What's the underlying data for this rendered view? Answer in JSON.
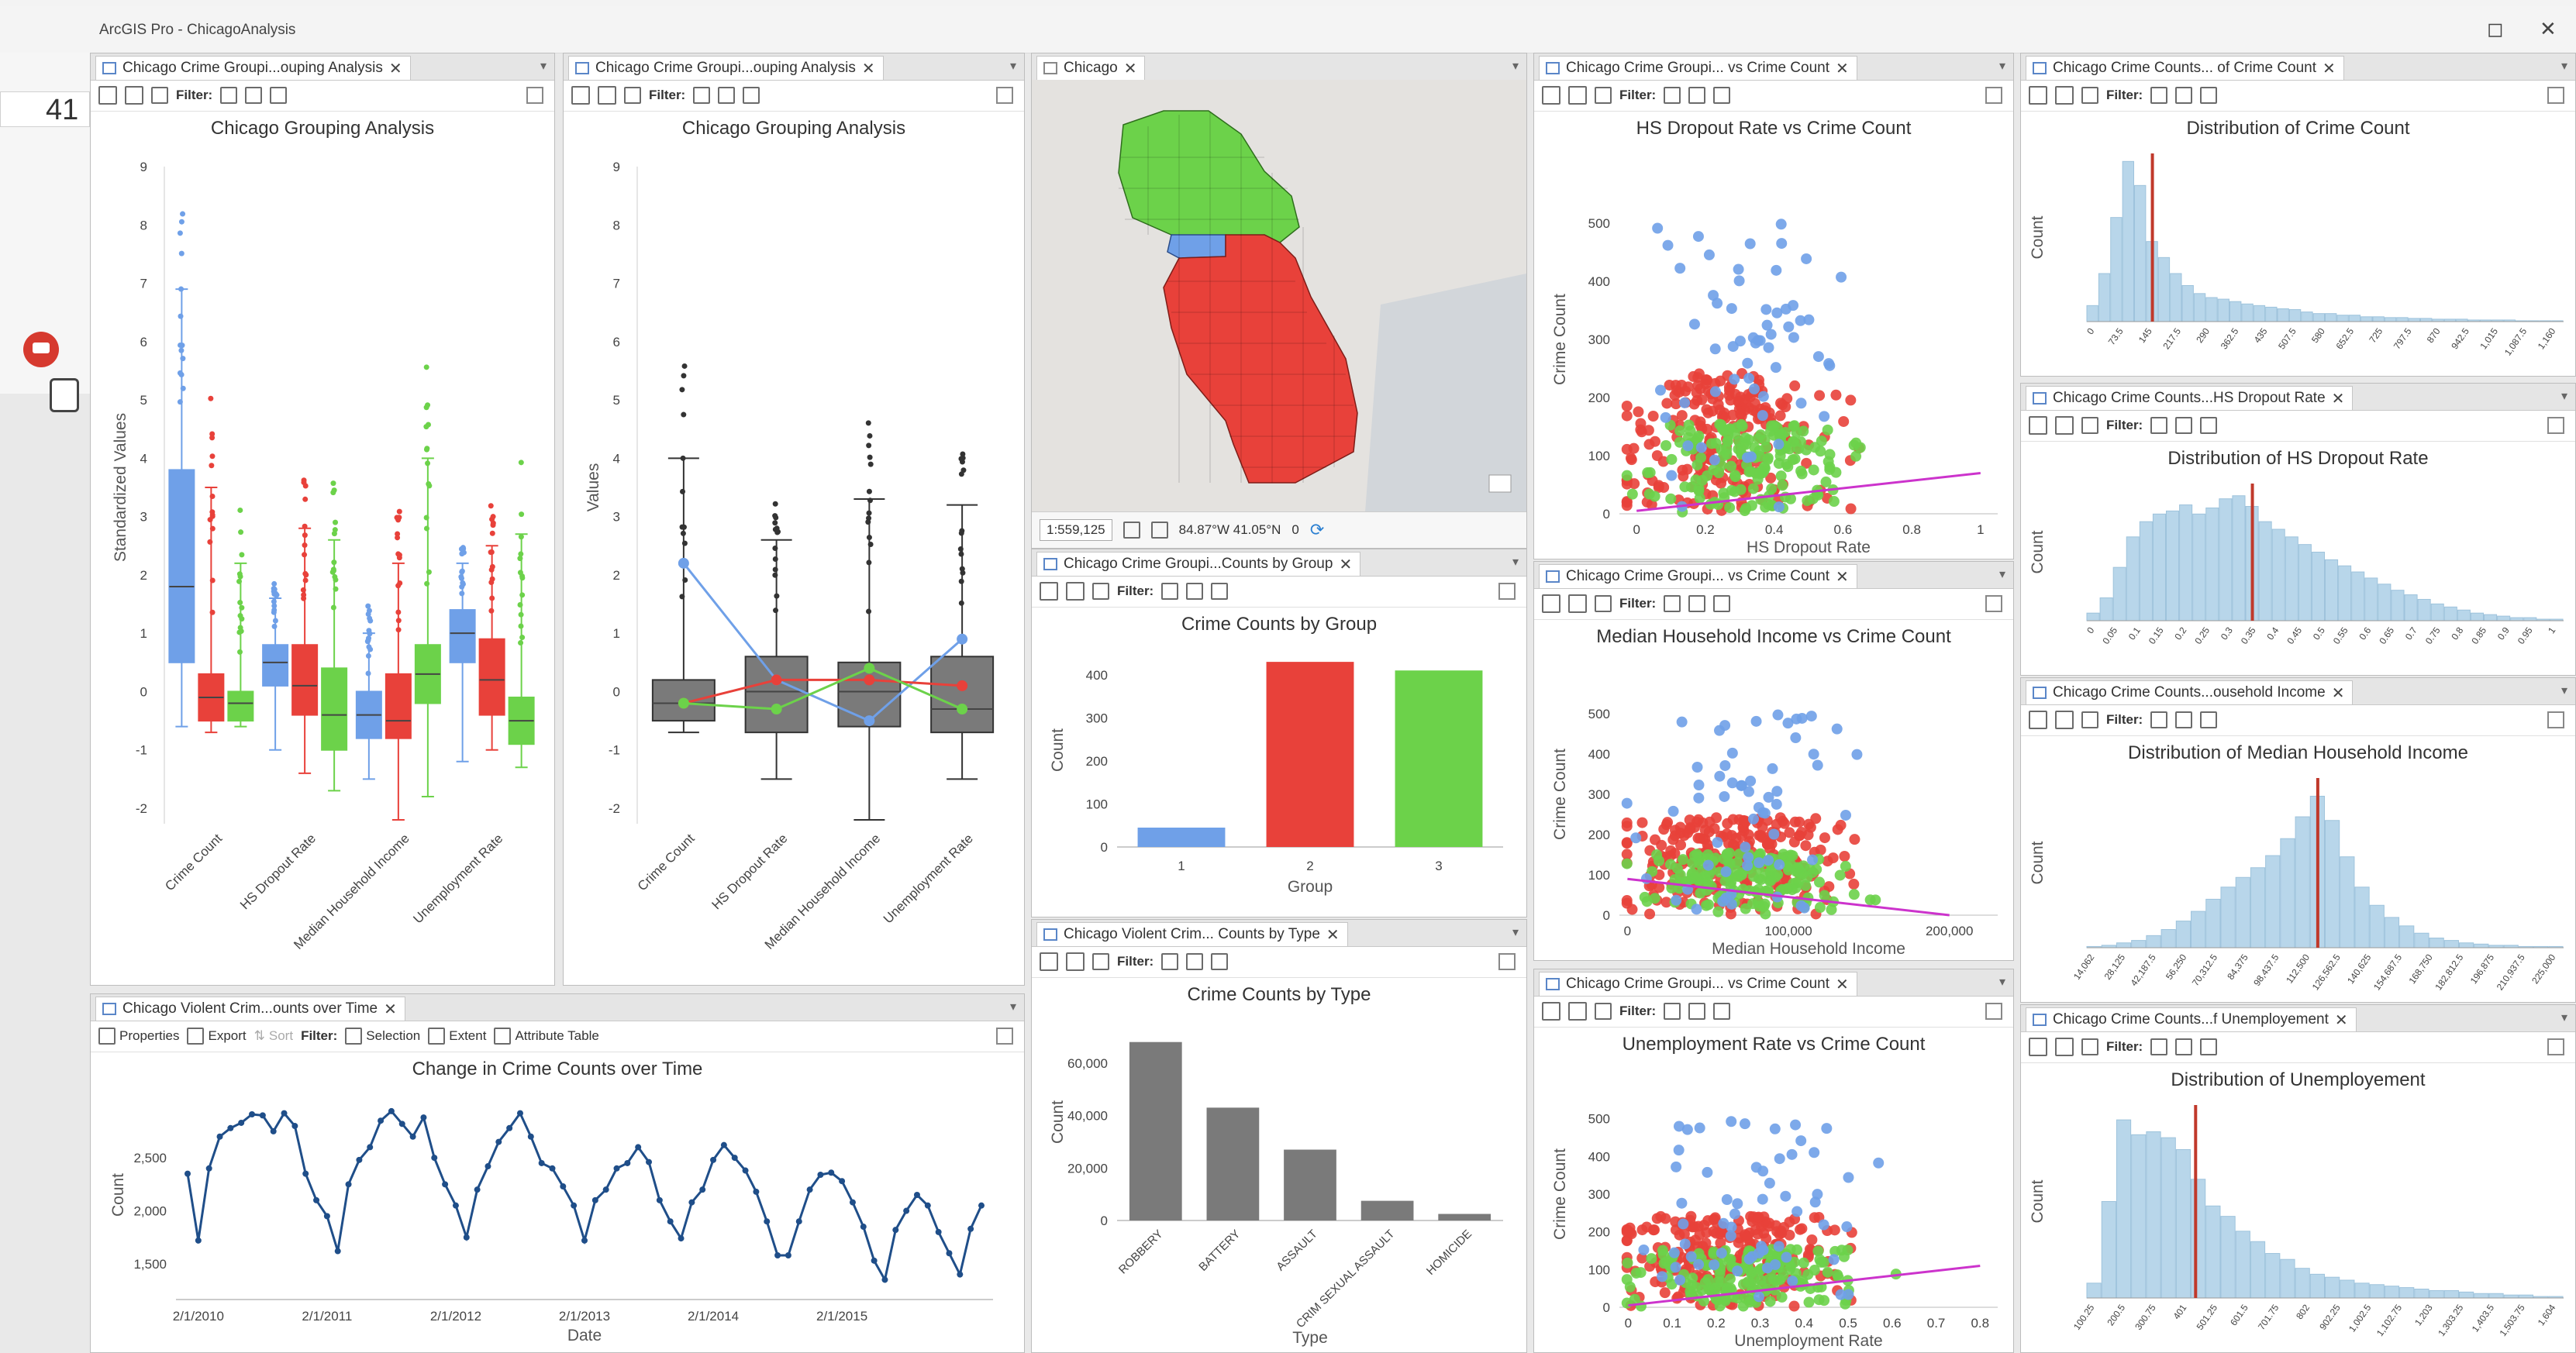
{
  "app": {
    "title": "ArcGIS Pro - ChicagoAnalysis",
    "restore": "◻",
    "close": "✕"
  },
  "side": {
    "badge": "41"
  },
  "toolbar": {
    "filter_label": "Filter:",
    "properties": "Properties",
    "export": "Export",
    "sort": "Sort",
    "selection": "Selection",
    "extent": "Extent",
    "attribute_table": "Attribute Table"
  },
  "colors": {
    "blue": "#6fa0e8",
    "red": "#e8413a",
    "green": "#6cd24a",
    "gray": "#7a7a7a",
    "hist": "#b8d6ea",
    "mean": "#c0392b",
    "line": "#1f4e89",
    "trend": "#cc33cc"
  },
  "panes": {
    "box1": {
      "tab": "Chicago Crime Groupi...ouping Analysis"
    },
    "box2": {
      "tab": "Chicago Crime Groupi...ouping Analysis"
    },
    "map": {
      "tab": "Chicago",
      "scale": "1:559,125",
      "coords": "84.87°W 41.05°N",
      "sel": "0"
    },
    "bar_group": {
      "tab": "Chicago Crime Groupi...Counts by Group"
    },
    "bar_type": {
      "tab": "Chicago Violent Crim... Counts by Type"
    },
    "line": {
      "tab": "Chicago Violent Crim...ounts over Time"
    },
    "sc1": {
      "tab": "Chicago Crime Groupi... vs Crime Count"
    },
    "sc2": {
      "tab": "Chicago Crime Groupi... vs Crime Count"
    },
    "sc3": {
      "tab": "Chicago Crime Groupi... vs Crime Count"
    },
    "h1": {
      "tab": "Chicago Crime Counts... of Crime Count"
    },
    "h2": {
      "tab": "Chicago Crime Counts...HS Dropout Rate"
    },
    "h3": {
      "tab": "Chicago Crime Counts...ousehold Income"
    },
    "h4": {
      "tab": "Chicago Crime Counts...f Unemployement"
    }
  },
  "chart_data": [
    {
      "id": "box1",
      "type": "box",
      "title": "Chicago Grouping Analysis",
      "ylabel": "Standardized Values",
      "ylim": [
        -2,
        9
      ],
      "categories": [
        "Crime Count",
        "HS Dropout Rate",
        "Median Household Income",
        "Unemployment Rate"
      ],
      "series": [
        {
          "group": 1,
          "boxes": [
            [
              -0.6,
              0.5,
              1.8,
              3.8,
              6.9
            ],
            [
              -1.0,
              0.1,
              0.5,
              0.8,
              1.6
            ],
            [
              -1.5,
              -0.8,
              -0.4,
              0.0,
              1.0
            ],
            [
              -1.2,
              0.5,
              1.0,
              1.4,
              2.2
            ]
          ]
        },
        {
          "group": 2,
          "boxes": [
            [
              -0.7,
              -0.5,
              -0.1,
              0.3,
              3.5
            ],
            [
              -1.4,
              -0.4,
              0.1,
              0.8,
              2.8
            ],
            [
              -2.2,
              -0.8,
              -0.5,
              0.3,
              2.2
            ],
            [
              -1.0,
              -0.4,
              0.2,
              0.9,
              2.5
            ]
          ]
        },
        {
          "group": 3,
          "boxes": [
            [
              -0.6,
              -0.5,
              -0.2,
              0.0,
              2.2
            ],
            [
              -1.7,
              -1.0,
              -0.4,
              0.4,
              2.6
            ],
            [
              -1.8,
              -0.2,
              0.3,
              0.8,
              4.0
            ],
            [
              -1.3,
              -0.9,
              -0.5,
              -0.1,
              2.7
            ]
          ]
        }
      ]
    },
    {
      "id": "box2",
      "type": "box",
      "title": "Chicago Grouping Analysis",
      "ylabel": "Values",
      "ylim": [
        -2,
        9
      ],
      "categories": [
        "Crime Count",
        "HS Dropout Rate",
        "Median Household Income",
        "Unemployment Rate"
      ],
      "boxes": [
        [
          -0.7,
          -0.5,
          -0.2,
          0.2,
          4.0
        ],
        [
          -1.5,
          -0.7,
          0.0,
          0.6,
          2.6
        ],
        [
          -2.2,
          -0.6,
          0.0,
          0.5,
          3.3
        ],
        [
          -1.5,
          -0.7,
          -0.3,
          0.6,
          3.2
        ]
      ],
      "lines": [
        {
          "group": 1,
          "values": [
            2.2,
            0.2,
            -0.5,
            0.9
          ]
        },
        {
          "group": 2,
          "values": [
            -0.2,
            0.2,
            0.2,
            0.1
          ]
        },
        {
          "group": 3,
          "values": [
            -0.2,
            -0.3,
            0.4,
            -0.3
          ]
        }
      ]
    },
    {
      "id": "bar_group",
      "type": "bar",
      "title": "Crime Counts by Group",
      "xlabel": "Group",
      "ylabel": "Count",
      "ylim": [
        0,
        450
      ],
      "categories": [
        "1",
        "2",
        "3"
      ],
      "values": [
        45,
        430,
        410
      ]
    },
    {
      "id": "bar_type",
      "type": "bar",
      "title": "Crime Counts by Type",
      "xlabel": "Type",
      "ylabel": "Count",
      "ylim": [
        0,
        75000
      ],
      "categories": [
        "ROBBERY",
        "BATTERY",
        "ASSAULT",
        "CRIM SEXUAL ASSAULT",
        "HOMICIDE"
      ],
      "values": [
        68000,
        43000,
        27000,
        7500,
        2500
      ]
    },
    {
      "id": "line",
      "type": "line",
      "title": "Change in Crime Counts over Time",
      "xlabel": "Date",
      "ylabel": "Count",
      "ylim": [
        1200,
        3100
      ],
      "x_ticks": [
        "2/1/2010",
        "2/1/2011",
        "2/1/2012",
        "2/1/2013",
        "2/1/2014",
        "2/1/2015"
      ],
      "values": [
        2350,
        1720,
        2400,
        2700,
        2780,
        2830,
        2910,
        2900,
        2750,
        2920,
        2800,
        2350,
        2100,
        1950,
        1620,
        2250,
        2480,
        2600,
        2850,
        2940,
        2820,
        2700,
        2880,
        2500,
        2250,
        2050,
        1750,
        2200,
        2420,
        2650,
        2780,
        2920,
        2700,
        2450,
        2400,
        2230,
        2050,
        1720,
        2100,
        2200,
        2400,
        2450,
        2600,
        2460,
        2100,
        1900,
        1740,
        2080,
        2200,
        2480,
        2620,
        2500,
        2380,
        2180,
        1900,
        1580,
        1580,
        1900,
        2200,
        2340,
        2360,
        2280,
        2080,
        1850,
        1530,
        1350,
        1820,
        2000,
        2150,
        2050,
        1800,
        1600,
        1400,
        1830,
        2050
      ]
    },
    {
      "id": "sc1",
      "type": "scatter",
      "title": "HS Dropout Rate vs Crime Count",
      "xlabel": "HS Dropout Rate",
      "ylabel": "Crime Count",
      "xlim": [
        -0.05,
        1.05
      ],
      "ylim": [
        0,
        600
      ],
      "x_ticks": [
        "0",
        "0.2",
        "0.4",
        "0.6",
        "0.8",
        "1"
      ],
      "y_ticks": [
        "0",
        "100",
        "200",
        "300",
        "400",
        "500"
      ],
      "trend": [
        [
          0,
          5
        ],
        [
          1,
          70
        ]
      ]
    },
    {
      "id": "sc2",
      "type": "scatter",
      "title": "Median Household Income vs Crime Count",
      "xlabel": "Median Household Income",
      "ylabel": "Crime Count",
      "xlim": [
        -5000,
        230000
      ],
      "ylim": [
        0,
        600
      ],
      "x_ticks": [
        "0",
        "100,000",
        "200,000"
      ],
      "y_ticks": [
        "0",
        "100",
        "200",
        "300",
        "400",
        "500"
      ],
      "trend": [
        [
          0,
          90
        ],
        [
          200000,
          0
        ]
      ]
    },
    {
      "id": "sc3",
      "type": "scatter",
      "title": "Unemployment Rate vs Crime Count",
      "xlabel": "Unemployment Rate",
      "ylabel": "Crime Count",
      "xlim": [
        -0.02,
        0.84
      ],
      "ylim": [
        0,
        600
      ],
      "x_ticks": [
        "0",
        "0.1",
        "0.2",
        "0.3",
        "0.4",
        "0.5",
        "0.6",
        "0.7",
        "0.8"
      ],
      "y_ticks": [
        "0",
        "100",
        "200",
        "300",
        "400",
        "500"
      ],
      "trend": [
        [
          0,
          5
        ],
        [
          0.8,
          110
        ]
      ]
    },
    {
      "id": "h1",
      "type": "histogram",
      "title": "Distribution of Crime Count",
      "ylabel": "Count",
      "ylim": [
        0,
        210
      ],
      "mean_bin": 5.5,
      "bins": [
        20,
        60,
        130,
        200,
        170,
        100,
        80,
        60,
        45,
        35,
        30,
        28,
        25,
        22,
        20,
        18,
        16,
        15,
        12,
        10,
        10,
        8,
        8,
        6,
        6,
        5,
        5,
        4,
        4,
        3,
        3,
        3,
        2,
        2,
        2,
        2,
        1,
        1,
        1,
        1
      ],
      "x_ticks": [
        "0",
        "73.5",
        "145",
        "217.5",
        "290",
        "362.5",
        "435",
        "507.5",
        "580",
        "652.5",
        "725",
        "797.5",
        "870",
        "942.5",
        "1,015",
        "1,087.5",
        "1,160"
      ]
    },
    {
      "id": "h2",
      "type": "histogram",
      "title": "Distribution of HS Dropout Rate",
      "ylabel": "Count",
      "ylim": [
        0,
        90
      ],
      "mean_bin": 12.5,
      "bins": [
        5,
        15,
        35,
        55,
        65,
        70,
        72,
        76,
        70,
        74,
        80,
        82,
        75,
        65,
        60,
        55,
        50,
        45,
        40,
        36,
        32,
        28,
        24,
        20,
        17,
        14,
        11,
        9,
        7,
        5,
        4,
        3,
        2,
        2,
        1,
        1
      ],
      "x_ticks": [
        "0",
        "0.05",
        "0.1",
        "0.15",
        "0.2",
        "0.25",
        "0.3",
        "0.35",
        "0.4",
        "0.45",
        "0.5",
        "0.55",
        "0.6",
        "0.65",
        "0.7",
        "0.75",
        "0.8",
        "0.85",
        "0.9",
        "0.95",
        "1"
      ]
    },
    {
      "id": "h3",
      "type": "histogram",
      "title": "Distribution of Median Household Income",
      "ylabel": "Count",
      "ylim": [
        0,
        140
      ],
      "mean_bin": 15.5,
      "bins": [
        1,
        2,
        4,
        6,
        10,
        15,
        22,
        30,
        40,
        50,
        58,
        66,
        76,
        90,
        108,
        125,
        105,
        75,
        50,
        35,
        25,
        18,
        12,
        8,
        6,
        4,
        3,
        2,
        2,
        1,
        1,
        1
      ],
      "x_ticks": [
        "14,062",
        "28,125",
        "42,187.5",
        "56,250",
        "70,312.5",
        "84,375",
        "98,437.5",
        "112,500",
        "126,562.5",
        "140,625",
        "154,687.5",
        "168,750",
        "182,812.5",
        "196,875",
        "210,937.5",
        "225,000"
      ]
    },
    {
      "id": "h4",
      "type": "histogram",
      "title": "Distribution of Unemployement",
      "ylabel": "Count",
      "ylim": [
        0,
        130
      ],
      "mean_bin": 7.3,
      "bins": [
        10,
        65,
        120,
        110,
        112,
        108,
        100,
        80,
        62,
        55,
        45,
        38,
        30,
        26,
        20,
        16,
        14,
        12,
        10,
        9,
        8,
        7,
        6,
        5,
        5,
        4,
        3,
        3,
        2,
        2,
        1,
        1
      ],
      "x_ticks": [
        "100.25",
        "200.5",
        "300.75",
        "401",
        "501.25",
        "601.5",
        "701.75",
        "802",
        "902.25",
        "1,002.5",
        "1,102.75",
        "1,203",
        "1,303.25",
        "1,403.5",
        "1,503.75",
        "1,604"
      ]
    }
  ]
}
